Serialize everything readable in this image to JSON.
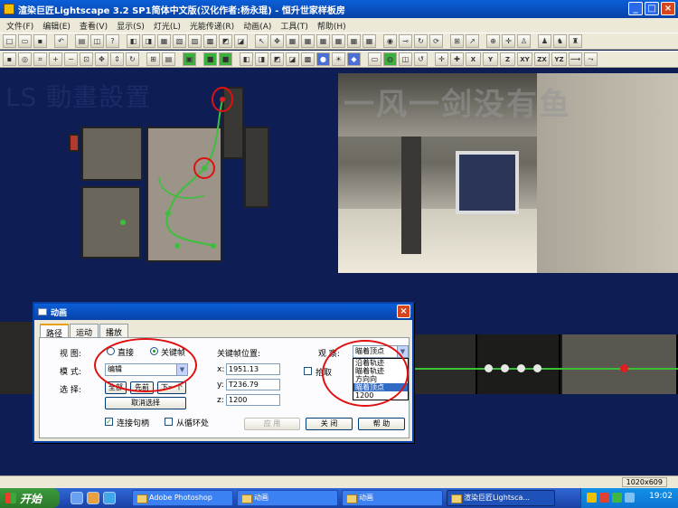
{
  "window": {
    "title": "渲染巨匠Lightscape 3.2 SP1简体中文版(汉化作者:杨永琨) - 恒升世家样板房",
    "controls": [
      "_",
      "□",
      "×"
    ]
  },
  "menu": {
    "items": [
      "文件(F)",
      "编辑(E)",
      "查看(V)",
      "显示(S)",
      "灯光(L)",
      "光能传递(R)",
      "动画(A)",
      "工具(T)",
      "帮助(H)"
    ]
  },
  "toolbar2": {
    "axis_labels": [
      "X",
      "Y",
      "Z",
      "XY",
      "ZX",
      "YZ"
    ]
  },
  "workspace": {
    "overlay_title": "LS 動畫設置",
    "watermark": "一风一剑没有鱼"
  },
  "dialog": {
    "title": "动画",
    "close": "×",
    "tabs": [
      "路径",
      "运动",
      "播放"
    ],
    "view_label": "视 图:",
    "view_options": [
      "直接",
      "关键帧"
    ],
    "mode_label": "模 式:",
    "mode_value": "编辑",
    "select_label": "选 择:",
    "select_buttons": [
      "全部",
      "先前",
      "下一个"
    ],
    "cancel_select": "取消选择",
    "keyframe_pos_label": "关键帧位置:",
    "x_label": "x:",
    "x_value": "1951.13",
    "y_label": "y:",
    "y_value": "T236.79",
    "z_label": "z:",
    "z_value": "1200",
    "observe_label": "观 察:",
    "observe_value": "瞄着顶点",
    "observe_options": [
      "沿着轨迹",
      "瞄着轨迹",
      "方向向",
      "瞄着顶点",
      "1200"
    ],
    "pick_label": "拾取",
    "connect_handles": "连接句柄",
    "loop_from": "从循环处",
    "apply": "应 用",
    "close_btn": "关 闭",
    "help": "帮 助"
  },
  "status": {
    "resolution": "1020x609"
  },
  "taskbar": {
    "start": "开始",
    "tasks": [
      "Adobe Photoshop",
      "动画",
      "动画",
      "渲染巨匠Lightsca..."
    ],
    "clock": "19:02"
  }
}
